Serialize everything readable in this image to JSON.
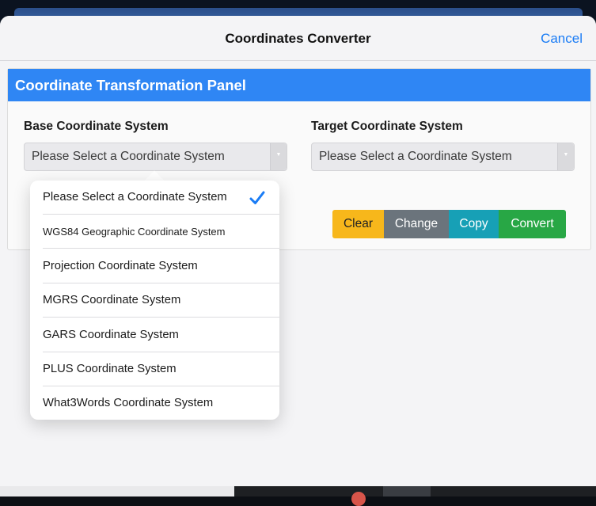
{
  "navbar": {
    "title": "Coordinates Converter",
    "cancel_label": "Cancel"
  },
  "panel": {
    "header": "Coordinate Transformation Panel",
    "base_label": "Base Coordinate System",
    "target_label": "Target Coordinate System",
    "base_select_value": "Please Select a Coordinate System",
    "target_select_value": "Please Select a Coordinate System"
  },
  "buttons": {
    "clear": "Clear",
    "change": "Change",
    "copy": "Copy",
    "convert": "Convert"
  },
  "dropdown": {
    "selected_index": 0,
    "items": [
      "Please Select a Coordinate System",
      "WGS84 Geographic Coordinate System",
      "Projection Coordinate System",
      "MGRS Coordinate System",
      "GARS Coordinate System",
      "PLUS Coordinate System",
      "What3Words Coordinate System"
    ]
  },
  "colors": {
    "accent": "#1a7cf5",
    "panel_header": "#2f86f4",
    "clear": "#f7b71b",
    "change": "#6b747c",
    "copy": "#17a0b6",
    "convert": "#28a745"
  },
  "icons": {
    "selected_check": "checkmark-icon",
    "select_arrow": "chevron-down-icon"
  }
}
